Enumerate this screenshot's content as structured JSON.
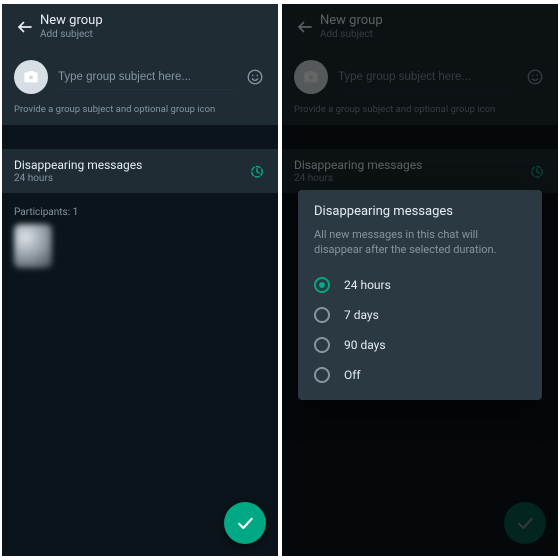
{
  "appbar": {
    "title": "New group",
    "subtitle": "Add subject"
  },
  "subject": {
    "placeholder": "Type group subject here..."
  },
  "hint": "Provide a group subject and optional group icon",
  "dm": {
    "title": "Disappearing messages",
    "value": "24 hours"
  },
  "participants_label": "Participants: 1",
  "dialog": {
    "title": "Disappearing messages",
    "desc": "All new messages in this chat will disappear after the selected duration.",
    "options": {
      "o0": "24 hours",
      "o1": "7 days",
      "o2": "90 days",
      "o3": "Off"
    },
    "selected_index": 0
  },
  "colors": {
    "accent": "#00a884",
    "surface": "#1f2c33",
    "bg": "#0b141a",
    "dialog": "#2a3942"
  }
}
